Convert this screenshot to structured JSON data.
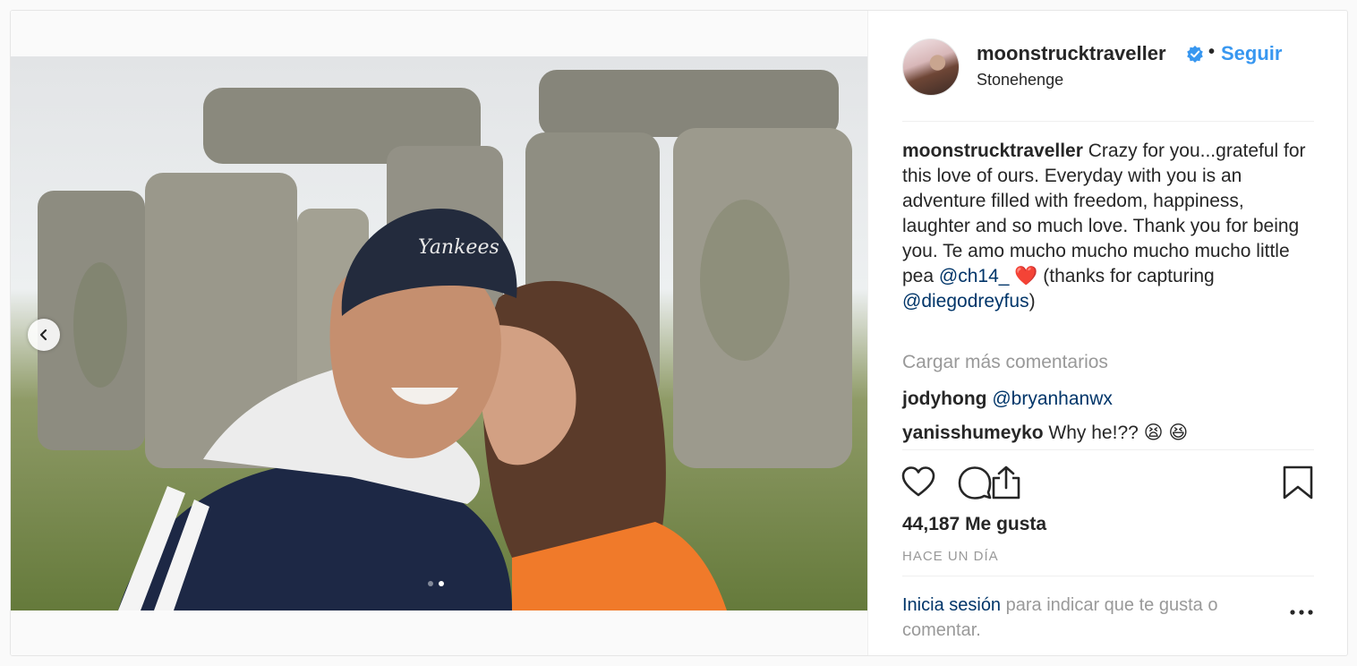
{
  "post": {
    "username": "moonstrucktraveller",
    "verified": true,
    "separator": "•",
    "follow_label": "Seguir",
    "location": "Stonehenge"
  },
  "media": {
    "slide_count": 2,
    "active_slide": 2
  },
  "caption": {
    "user": "moonstrucktraveller",
    "text": "Crazy for you...grateful for this love of ours. Everyday with you is an adventure filled with freedom, happiness, laughter and so much love. Thank you for being you. Te amo mucho mucho mucho mucho little pea",
    "mention1": "@ch14_",
    "heart": "❤️",
    "text2": "(thanks for capturing",
    "mention2": "@diegodreyfus",
    "text3": ")"
  },
  "load_more": "Cargar más comentarios",
  "comments": [
    {
      "user": "jodyhong",
      "text": "",
      "mention": "@bryanhanwx"
    },
    {
      "user": "yanisshumeyko",
      "text": "Why he!?? 😫 😆",
      "mention": ""
    }
  ],
  "likes": "44,187 Me gusta",
  "timestamp": "HACE UN DÍA",
  "login": {
    "link": "Inicia sesión",
    "text": "para indicar que te gusta o comentar."
  },
  "colors": {
    "accent": "#3897f0",
    "mention": "#003569",
    "muted": "#999999",
    "text": "#262626"
  }
}
